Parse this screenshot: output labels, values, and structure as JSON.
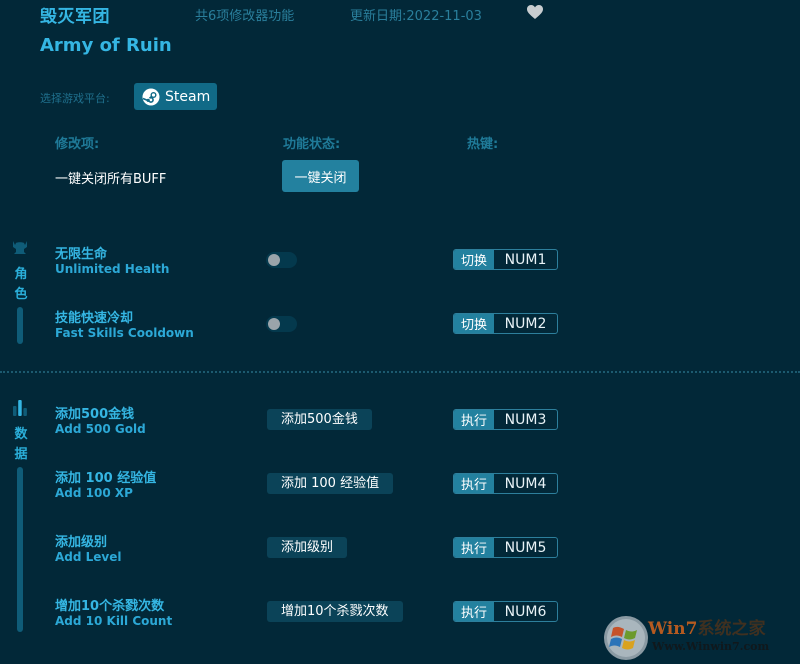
{
  "header": {
    "title_cn": "毁灭军团",
    "feature_count": "共6项修改器功能",
    "update_date": "更新日期:2022-11-03",
    "favorite_icon": "heart-icon",
    "title_en": "Army of Ruin"
  },
  "platform": {
    "label": "选择游戏平台:",
    "selected": "Steam",
    "icon": "steam-icon"
  },
  "columns": {
    "modifier": "修改项:",
    "state": "功能状态:",
    "hotkey": "热键:"
  },
  "global_action": {
    "label": "一键关闭所有BUFF",
    "button": "一键关闭"
  },
  "categories": [
    {
      "name": "角色",
      "icon": "character-helmet-icon",
      "chars": [
        "角",
        "色"
      ],
      "items": [
        {
          "cn": "无限生命",
          "en": "Unlimited Health",
          "control": "toggle",
          "enabled": false,
          "hotkey_type": "切换",
          "hotkey": "NUM1"
        },
        {
          "cn": "技能快速冷却",
          "en": "Fast Skills Cooldown",
          "control": "toggle",
          "enabled": false,
          "hotkey_type": "切换",
          "hotkey": "NUM2"
        }
      ]
    },
    {
      "name": "数据",
      "icon": "bar-chart-icon",
      "chars": [
        "数",
        "据"
      ],
      "items": [
        {
          "cn": "添加500金钱",
          "en": "Add 500 Gold",
          "control": "button",
          "button": "添加500金钱",
          "hotkey_type": "执行",
          "hotkey": "NUM3"
        },
        {
          "cn": "添加 100 经验值",
          "en": "Add 100 XP",
          "control": "button",
          "button": "添加 100 经验值",
          "hotkey_type": "执行",
          "hotkey": "NUM4"
        },
        {
          "cn": "添加级别",
          "en": "Add Level",
          "control": "button",
          "button": "添加级别",
          "hotkey_type": "执行",
          "hotkey": "NUM5"
        },
        {
          "cn": "增加10个杀戮次数",
          "en": "Add 10 Kill Count",
          "control": "button",
          "button": "增加10个杀戮次数",
          "hotkey_type": "执行",
          "hotkey": "NUM6"
        }
      ]
    }
  ],
  "watermark": {
    "brand_latin": "Win7",
    "brand_cn": "系统之家",
    "url": "Www.Winwin7.com",
    "logo": "windows-logo-icon"
  },
  "colors": {
    "background": "#022838",
    "accent": "#35b6e3",
    "button": "#23819f",
    "steam_button": "#116a87"
  }
}
